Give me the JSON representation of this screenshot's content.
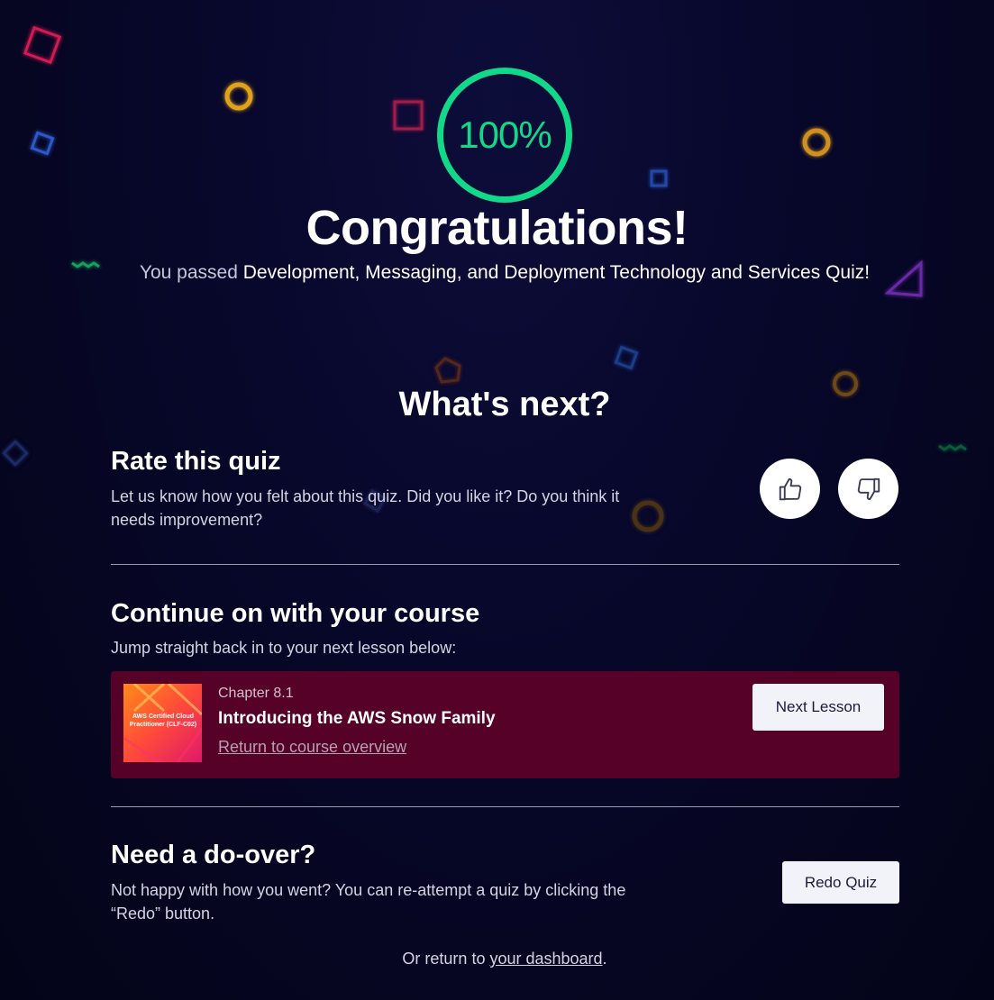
{
  "colors": {
    "background": "#050520",
    "score_accent": "#12d98a",
    "lesson_card": "#550128",
    "button_bg": "#f1f3f8"
  },
  "result": {
    "score": "100%",
    "heading": "Congratulations!",
    "passed_prefix": "You passed",
    "quiz_name": "Development, Messaging, and Deployment Technology and Services Quiz",
    "passed_suffix": "!"
  },
  "whats_next": {
    "heading": "What's next?"
  },
  "rate": {
    "title": "Rate this quiz",
    "description": "Let us know how you felt about this quiz. Did you like it? Do you think it needs improvement?",
    "thumbs_up_icon": "thumbs-up-icon",
    "thumbs_down_icon": "thumbs-down-icon"
  },
  "continue": {
    "title": "Continue on with your course",
    "description": "Jump straight back in to your next lesson below:",
    "lesson": {
      "thumbnail_text": "AWS Certified Cloud Practitioner (CLF-C02)",
      "chapter": "Chapter 8.1",
      "title": "Introducing the AWS Snow Family",
      "overview_link": "Return to course overview",
      "next_button": "Next Lesson"
    }
  },
  "redo": {
    "title": "Need a do-over?",
    "description": "Not happy with how you went? You can re-attempt a quiz by clicking the “Redo” button.",
    "button": "Redo Quiz"
  },
  "footer": {
    "prefix": "Or return to ",
    "link": "your dashboard",
    "suffix": "."
  }
}
